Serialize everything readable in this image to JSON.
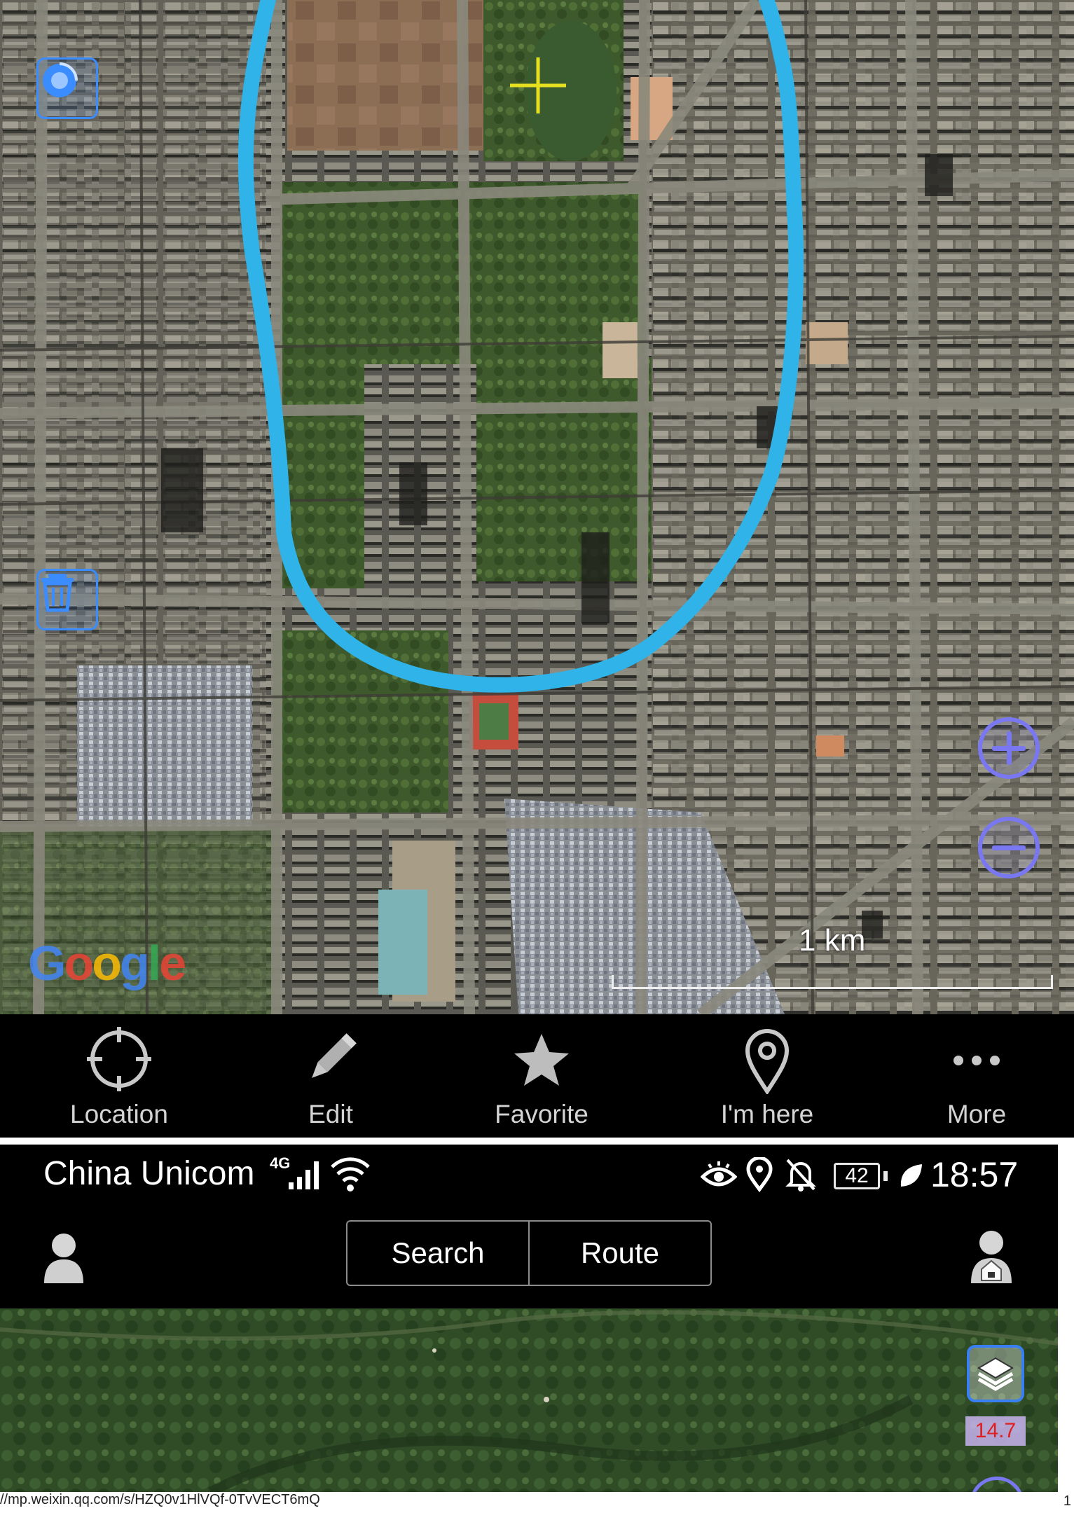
{
  "map": {
    "scale_label": "1 km",
    "attribution": [
      "G",
      "o",
      "o",
      "g",
      "l",
      "e"
    ],
    "attribution_colors": [
      "#4285f4",
      "#ea4335",
      "#fbbc05",
      "#4285f4",
      "#34a853",
      "#ea4335"
    ],
    "route_color": "#2fb3e8",
    "crosshair_color": "#e6e020",
    "controls_color": "#3a8cff",
    "zoom_color": "#7a78f0"
  },
  "toolbar": {
    "items": [
      {
        "label": "Location",
        "icon": "crosshair-icon"
      },
      {
        "label": "Edit",
        "icon": "pencil-icon"
      },
      {
        "label": "Favorite",
        "icon": "star-icon"
      },
      {
        "label": "I'm here",
        "icon": "map-pin-icon"
      },
      {
        "label": "More",
        "icon": "more-dots-icon"
      }
    ]
  },
  "status_bar": {
    "carrier": "China Unicom",
    "network": "4G",
    "battery": "42",
    "time": "18:57"
  },
  "app_bar": {
    "search_label": "Search",
    "route_label": "Route"
  },
  "map2": {
    "zoom_level": "14.7"
  },
  "footer": {
    "url": "//mp.weixin.qq.com/s/HZQ0v1HlVQf-0TvVECT6mQ",
    "page_number": "1"
  }
}
